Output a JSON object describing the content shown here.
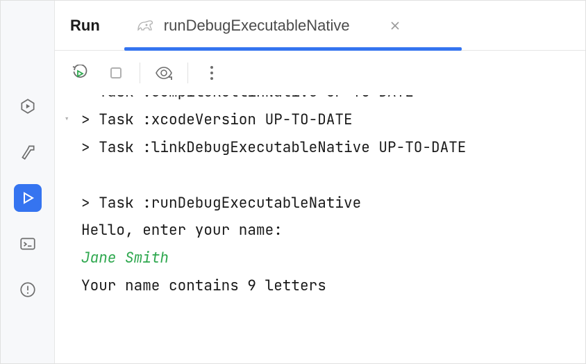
{
  "tabs": {
    "run_label": "Run",
    "config_label": "runDebugExecutableNative"
  },
  "console": {
    "cut_line": "  Task :compileKotlinNative UP-TO-DATE",
    "line1": "> Task :xcodeVersion UP-TO-DATE",
    "line2": "> Task :linkDebugExecutableNative UP-TO-DATE",
    "blank": " ",
    "line3": "> Task :runDebugExecutableNative",
    "prompt": "Hello, enter your name:",
    "input": "Jane Smith",
    "result": "Your name contains 9 letters"
  },
  "rail": {
    "services": "services-icon",
    "build": "build-icon",
    "run": "run-icon",
    "terminal": "terminal-icon",
    "problems": "problems-icon"
  },
  "toolbar": {
    "rerun": "rerun-icon",
    "stop": "stop-icon",
    "eye": "eye-icon",
    "more": "more-icon"
  }
}
